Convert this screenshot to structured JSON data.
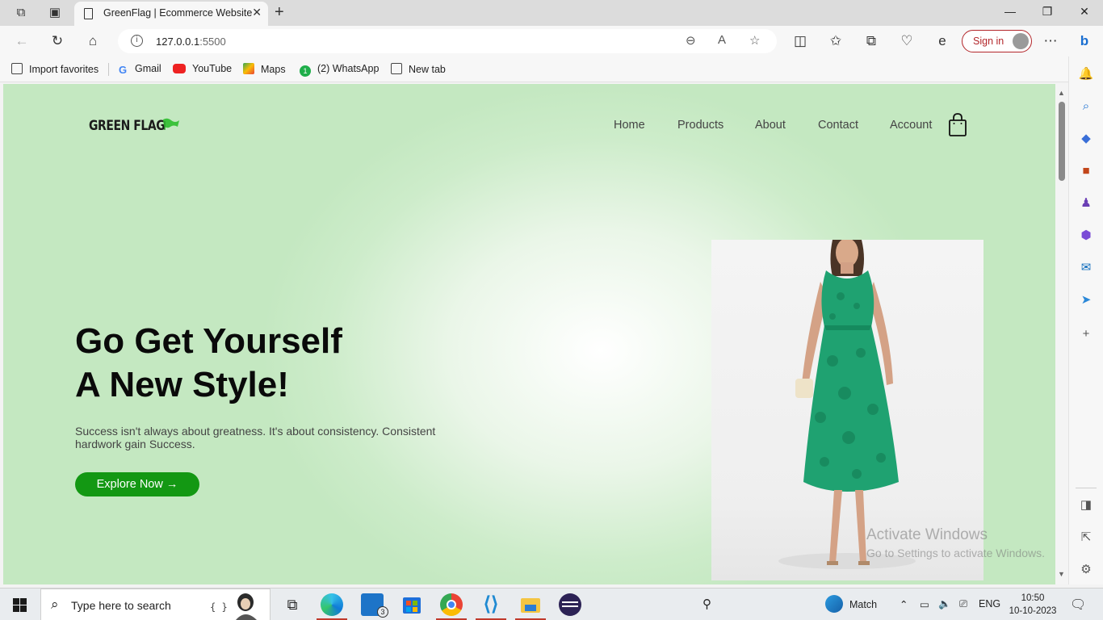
{
  "browser": {
    "tab_title": "GreenFlag | Ecommerce Website",
    "url_host": "127.0.0.1",
    "url_port": ":5500",
    "sign_in_label": "Sign in",
    "favorites": [
      {
        "label": "Import favorites",
        "icon": "import-favorites-icon"
      },
      {
        "label": "Gmail",
        "icon": "google-icon"
      },
      {
        "label": "YouTube",
        "icon": "youtube-icon"
      },
      {
        "label": "Maps",
        "icon": "maps-icon"
      },
      {
        "label": "(2) WhatsApp",
        "icon": "whatsapp-icon"
      },
      {
        "label": "New tab",
        "icon": "new-tab-icon"
      }
    ]
  },
  "site": {
    "logo_text": "GREEN FLAG",
    "nav": [
      "Home",
      "Products",
      "About",
      "Contact",
      "Account"
    ],
    "hero": {
      "title_line1": "Go Get Yourself",
      "title_line2": "A New Style!",
      "subtitle": "Success isn't always about greatness. It's about consistency. Consistent hardwork gain Success.",
      "cta_label": "Explore Now →"
    },
    "colors": {
      "accent": "#139813",
      "background": "#c4e8c1",
      "dress": "#1fa271"
    }
  },
  "watermark": {
    "line1": "Activate Windows",
    "line2": "Go to Settings to activate Windows."
  },
  "taskbar": {
    "search_placeholder": "Type here to search",
    "mail_badge": "3",
    "weather_label": "Match",
    "language": "ENG",
    "time": "10:50",
    "date": "10-10-2023"
  }
}
